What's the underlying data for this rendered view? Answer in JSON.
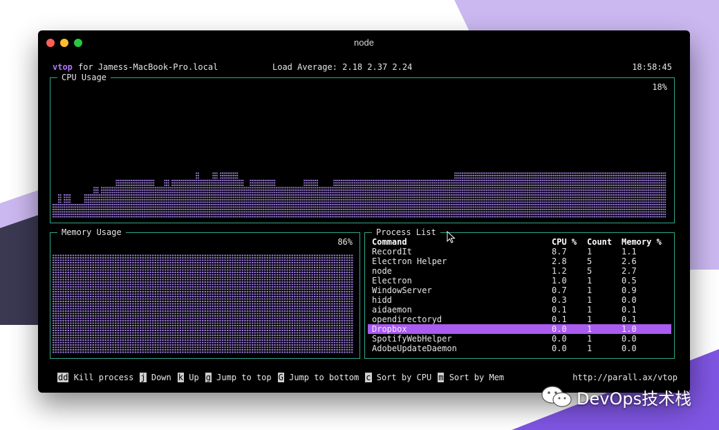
{
  "window": {
    "title": "node"
  },
  "header": {
    "app": "vtop",
    "host": "for Jamess-MacBook-Pro.local",
    "load_average": "Load Average: 2.18 2.37 2.24",
    "time": "18:58:45"
  },
  "cpu": {
    "title": "CPU Usage",
    "percent": "18%",
    "history_percent": [
      12,
      12,
      12,
      18,
      18,
      12,
      18,
      18,
      18,
      18,
      12,
      12,
      12,
      12,
      12,
      12,
      12,
      18,
      18,
      18,
      18,
      18,
      24,
      24,
      24,
      18,
      24,
      24,
      24,
      24,
      24,
      24,
      24,
      24,
      30,
      30,
      30,
      30,
      30,
      30,
      30,
      30,
      30,
      30,
      30,
      30,
      30,
      30,
      30,
      30,
      30,
      30,
      30,
      30,
      30,
      24,
      24,
      24,
      24,
      24,
      30,
      30,
      30,
      24,
      30,
      30,
      30,
      30,
      30,
      30,
      30,
      30,
      30,
      30,
      30,
      30,
      30,
      36,
      36,
      30,
      30,
      30,
      30,
      30,
      30,
      30,
      36,
      36,
      36,
      30,
      36,
      36,
      36,
      36,
      36,
      36,
      36,
      36,
      36,
      36,
      30,
      30,
      30,
      24,
      24,
      24,
      30,
      30,
      30,
      30,
      30,
      30,
      30,
      30,
      30,
      30,
      30,
      30,
      30,
      30,
      24,
      24,
      24,
      24,
      24,
      24,
      24,
      24,
      24,
      24,
      24,
      24,
      24,
      24,
      24,
      30,
      30,
      30,
      30,
      30,
      30,
      30,
      30,
      24,
      24,
      24,
      24,
      24,
      24,
      24,
      24,
      30,
      30,
      30,
      30,
      30,
      30,
      30,
      30,
      30,
      30,
      30,
      30,
      30,
      30,
      30,
      30,
      30,
      30,
      30,
      30,
      30,
      30,
      30,
      30,
      30,
      30,
      30,
      30,
      30,
      30,
      30,
      30,
      30,
      30,
      30,
      30,
      30,
      30,
      30,
      30,
      30,
      30,
      30,
      30,
      30,
      30,
      30,
      30,
      30,
      30,
      30,
      30,
      30,
      30,
      30,
      30,
      30,
      30,
      30,
      30,
      30,
      30,
      30,
      30,
      30,
      36,
      36,
      36,
      36,
      36,
      36,
      36,
      36,
      36,
      36,
      36,
      36,
      36,
      36,
      36,
      36,
      36,
      36,
      36,
      36,
      36,
      36,
      36,
      36,
      36,
      36,
      36,
      36,
      36,
      36,
      36,
      36,
      36,
      36,
      36,
      36,
      36,
      36,
      36,
      36,
      36,
      36,
      36,
      36,
      36,
      36,
      36,
      36,
      36,
      36,
      36,
      36,
      36,
      36,
      36,
      36,
      36,
      36,
      36,
      36,
      36,
      36,
      36,
      36,
      36,
      36,
      36,
      36,
      36,
      36,
      36,
      36,
      36,
      36,
      36,
      36,
      36,
      36,
      36,
      36,
      36,
      36,
      36,
      36,
      36,
      36,
      36,
      36,
      36,
      36,
      36,
      36,
      36,
      36,
      36,
      36,
      36,
      36,
      36,
      36,
      36,
      36,
      36,
      36,
      36,
      36,
      36,
      36,
      36,
      36,
      36,
      36,
      36,
      36
    ]
  },
  "memory": {
    "title": "Memory Usage",
    "percent": "86%",
    "fill_fraction": 0.86
  },
  "process_list": {
    "title": "Process List",
    "columns": [
      "Command",
      "CPU %",
      "Count",
      "Memory %"
    ],
    "rows": [
      {
        "command": "RecordIt",
        "cpu": "8.7",
        "count": "1",
        "memory": "1.1"
      },
      {
        "command": "Electron Helper",
        "cpu": "2.8",
        "count": "5",
        "memory": "2.6"
      },
      {
        "command": "node",
        "cpu": "1.2",
        "count": "5",
        "memory": "2.7"
      },
      {
        "command": "Electron",
        "cpu": "1.0",
        "count": "1",
        "memory": "0.5"
      },
      {
        "command": "WindowServer",
        "cpu": "0.7",
        "count": "1",
        "memory": "0.9"
      },
      {
        "command": "hidd",
        "cpu": "0.3",
        "count": "1",
        "memory": "0.0"
      },
      {
        "command": "aidaemon",
        "cpu": "0.1",
        "count": "1",
        "memory": "0.1"
      },
      {
        "command": "opendirectoryd",
        "cpu": "0.1",
        "count": "1",
        "memory": "0.1"
      },
      {
        "command": "Dropbox",
        "cpu": "0.0",
        "count": "1",
        "memory": "1.0",
        "selected": true
      },
      {
        "command": "SpotifyWebHelper",
        "cpu": "0.0",
        "count": "1",
        "memory": "0.0"
      },
      {
        "command": "AdobeUpdateDaemon",
        "cpu": "0.0",
        "count": "1",
        "memory": "0.0"
      }
    ]
  },
  "footer": {
    "hints": [
      {
        "key": "dd",
        "label": "Kill process"
      },
      {
        "key": "j",
        "label": "Down"
      },
      {
        "key": "k",
        "label": "Up"
      },
      {
        "key": "g",
        "label": "Jump to top"
      },
      {
        "key": "G",
        "label": "Jump to bottom"
      },
      {
        "key": "c",
        "label": "Sort by CPU"
      },
      {
        "key": "m",
        "label": "Sort by Mem"
      }
    ],
    "url": "http://parall.ax/vtop"
  },
  "watermark": {
    "text": "DevOps技术栈",
    "icon": "wechat-icon"
  },
  "colors": {
    "accent": "#a95cf0",
    "bar": "#9a7bd8",
    "border": "#2fa98c",
    "terminal_bg": "#000000"
  }
}
